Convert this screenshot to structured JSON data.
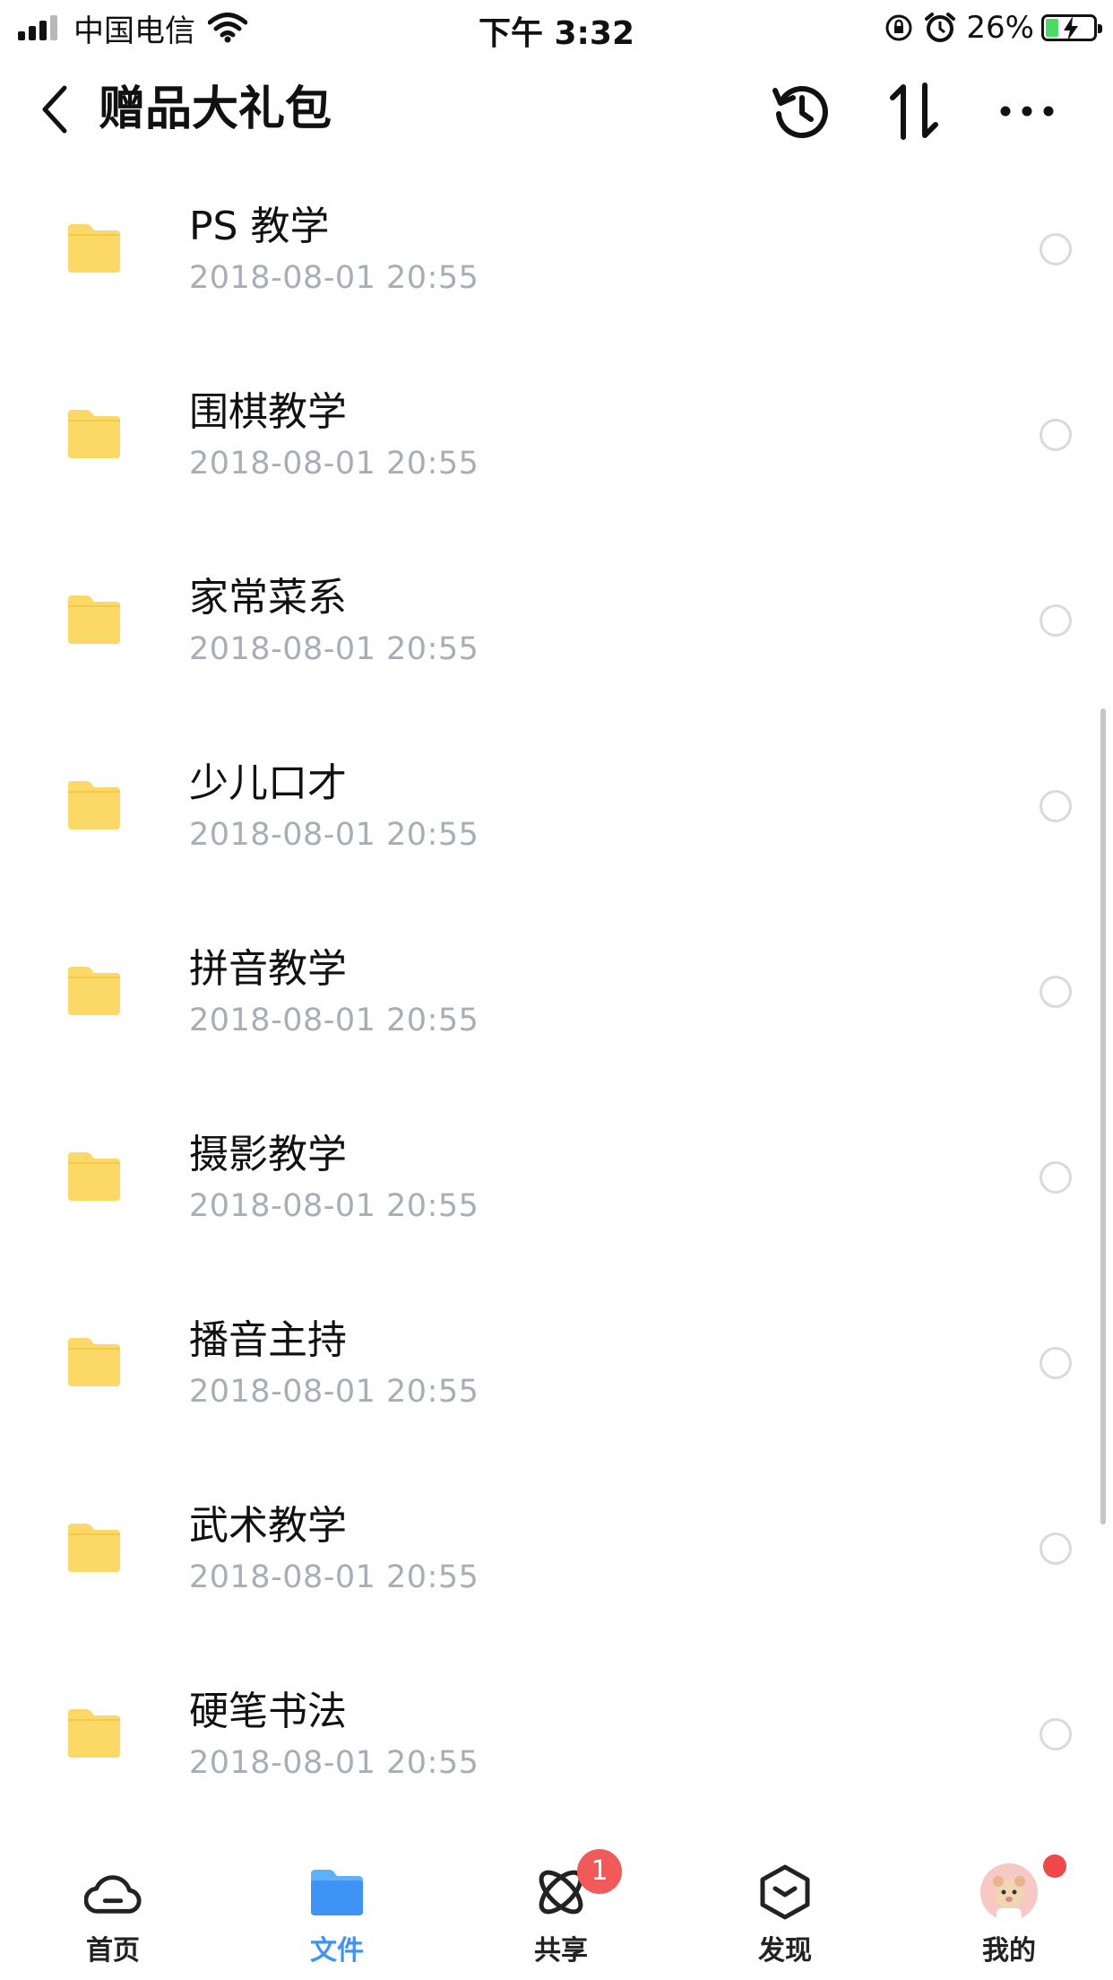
{
  "status_bar": {
    "carrier": "中国电信",
    "time": "下午 3:32",
    "battery_percent": "26%",
    "battery_level": 0.26
  },
  "header": {
    "title": "赠品大礼包"
  },
  "files": [
    {
      "name": "PS 教学",
      "date": "2018-08-01 20:55"
    },
    {
      "name": "围棋教学",
      "date": "2018-08-01 20:55"
    },
    {
      "name": "家常菜系",
      "date": "2018-08-01 20:55"
    },
    {
      "name": "少儿口才",
      "date": "2018-08-01 20:55"
    },
    {
      "name": "拼音教学",
      "date": "2018-08-01 20:55"
    },
    {
      "name": "摄影教学",
      "date": "2018-08-01 20:55"
    },
    {
      "name": "播音主持",
      "date": "2018-08-01 20:55"
    },
    {
      "name": "武术教学",
      "date": "2018-08-01 20:55"
    },
    {
      "name": "硬笔书法",
      "date": "2018-08-01 20:55"
    }
  ],
  "tabbar": {
    "home": "首页",
    "files": "文件",
    "share": "共享",
    "share_badge": "1",
    "discover": "发现",
    "mine": "我的"
  },
  "colors": {
    "folder": "#fcd967",
    "accent": "#3f93f5",
    "badge": "#f05a5a",
    "date_text": "#a8adb7"
  },
  "icons": [
    "back-icon",
    "history-icon",
    "sort-icon",
    "more-icon",
    "folder-icon",
    "cloud-icon",
    "files-icon",
    "share-icon",
    "discover-icon",
    "avatar"
  ]
}
